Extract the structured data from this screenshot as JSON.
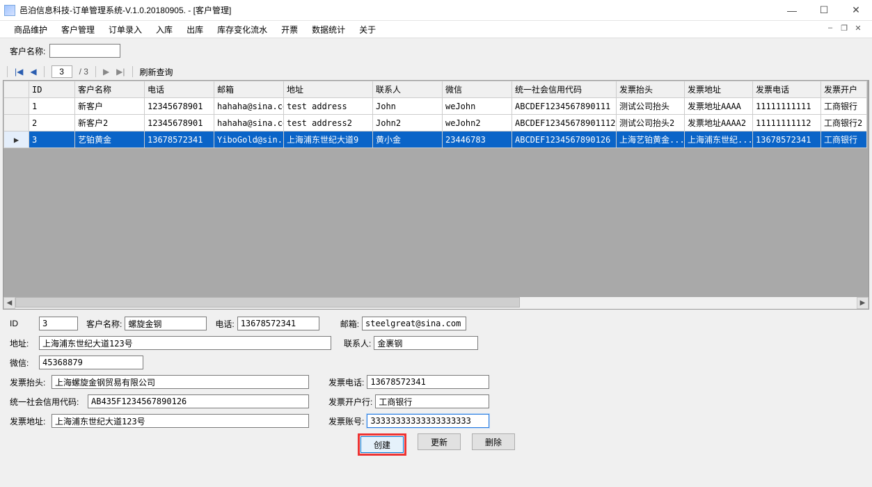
{
  "window": {
    "title": "邑泊信息科技-订单管理系统-V.1.0.20180905. - [客户管理]"
  },
  "menu": [
    "商品维护",
    "客户管理",
    "订单录入",
    "入库",
    "出库",
    "库存变化流水",
    "开票",
    "数据统计",
    "关于"
  ],
  "search": {
    "label": "客户名称:",
    "value": ""
  },
  "pager": {
    "current": "3",
    "total_label": "/ 3",
    "refresh_label": "刷新查询"
  },
  "grid": {
    "headers": [
      "ID",
      "客户名称",
      "电话",
      "邮箱",
      "地址",
      "联系人",
      "微信",
      "统一社会信用代码",
      "发票抬头",
      "发票地址",
      "发票电话",
      "发票开户"
    ],
    "rows": [
      {
        "sel": false,
        "id": "1",
        "name": "新客户",
        "tel": "12345678901",
        "mail": "hahaha@sina.com",
        "addr": "test address",
        "contact": "John",
        "wx": "weJohn",
        "code": "ABCDEF1234567890111",
        "inv_head": "测试公司抬头",
        "inv_addr": "发票地址AAAA",
        "inv_tel": "11111111111",
        "inv_bank": "工商银行"
      },
      {
        "sel": false,
        "id": "2",
        "name": "新客户2",
        "tel": "12345678901",
        "mail": "hahaha@sina.com",
        "addr": "test address2",
        "contact": "John2",
        "wx": "weJohn2",
        "code": "ABCDEF12345678901112",
        "inv_head": "测试公司抬头2",
        "inv_addr": "发票地址AAAA2",
        "inv_tel": "11111111112",
        "inv_bank": "工商银行2"
      },
      {
        "sel": true,
        "id": "3",
        "name": "艺铂黄金",
        "tel": "13678572341",
        "mail": "YiboGold@sin...",
        "addr": "上海浦东世纪大道9",
        "contact": "黄小金",
        "wx": "23446783",
        "code": "ABCDEF1234567890126",
        "inv_head": "上海艺铂黄金...",
        "inv_addr": "上海浦东世纪...",
        "inv_tel": "13678572341",
        "inv_bank": "工商银行"
      }
    ]
  },
  "form": {
    "id_label": "ID",
    "id": "3",
    "name_label": "客户名称:",
    "name": "螺旋金钢",
    "tel_label": "电话:",
    "tel": "13678572341",
    "mail_label": "邮箱:",
    "mail": "steelgreat@sina.com",
    "addr_label": "地址:",
    "addr": "上海浦东世纪大道123号",
    "contact_label": "联系人:",
    "contact": "金裹钢",
    "wx_label": "微信:",
    "wx": "45368879",
    "inv_head_label": "发票抬头:",
    "inv_head": "上海螺旋金钢贸易有限公司",
    "inv_tel_label": "发票电话:",
    "inv_tel": "13678572341",
    "code_label": "统一社会信用代码:",
    "code": "AB435F1234567890126",
    "inv_bank_label": "发票开户行:",
    "inv_bank": "工商银行",
    "inv_addr_label": "发票地址:",
    "inv_addr": "上海浦东世纪大道123号",
    "inv_acct_label": "发票账号:",
    "inv_acct": "33333333333333333333"
  },
  "buttons": {
    "create": "创建",
    "update": "更新",
    "delete": "删除"
  }
}
